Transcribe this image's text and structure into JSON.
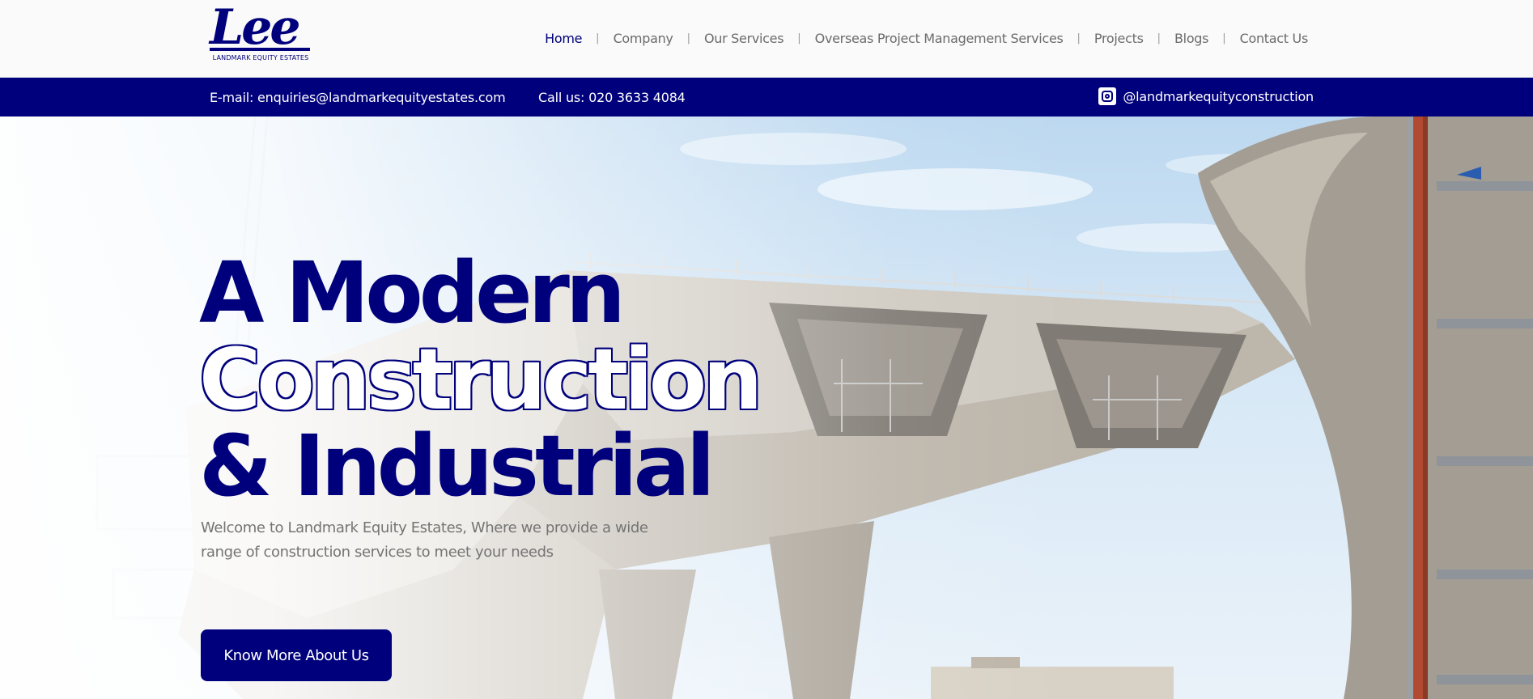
{
  "logo": {
    "mark": "Lee",
    "subtitle": "LANDMARK EQUITY ESTATES"
  },
  "nav": {
    "items": [
      {
        "label": "Home",
        "active": true
      },
      {
        "label": "Company"
      },
      {
        "label": "Our Services"
      },
      {
        "label": "Overseas Project Management Services"
      },
      {
        "label": "Projects"
      },
      {
        "label": "Blogs"
      },
      {
        "label": "Contact Us"
      }
    ],
    "separator": "|"
  },
  "infobar": {
    "email": "E-mail: enquiries@landmarkequityestates.com",
    "phone": "Call us: 020 3633 4084",
    "instagram_icon": "instagram-icon",
    "instagram_handle": "@landmarkequityconstruction"
  },
  "hero": {
    "line1": "A Modern",
    "line2": "Construction",
    "line3": "& Industrial",
    "description": "Welcome to Landmark Equity Estates, Where we provide a wide range of construction services to meet your needs",
    "cta_label": "Know More About Us"
  },
  "colors": {
    "brand": "#00007c",
    "nav_text": "#6b6b6b",
    "body_text": "#747474",
    "header_bg": "#fafafa"
  }
}
